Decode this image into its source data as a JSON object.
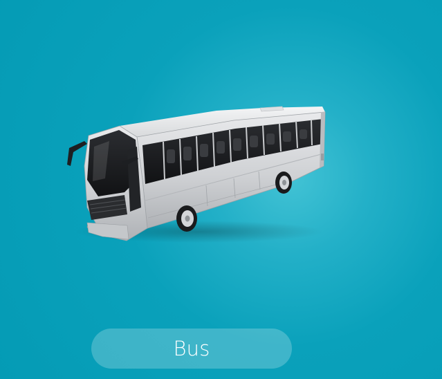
{
  "card": {
    "label": "Bus",
    "background_color": "#049bb5",
    "highlight_color": "#43c3d5",
    "pill_color": "rgba(255,255,255,0.22)"
  },
  "vehicle": {
    "icon": "bus-icon"
  }
}
